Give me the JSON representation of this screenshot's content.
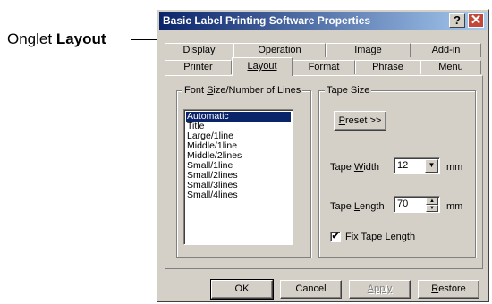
{
  "callout": {
    "prefix": "Onglet",
    "bold": "Layout"
  },
  "window": {
    "title": "Basic Label Printing Software Properties",
    "help_icon": "?",
    "close_icon": "✕"
  },
  "tabs": {
    "row_back": [
      "Display",
      "Operation",
      "Image",
      "Add-in"
    ],
    "row_front": [
      "Printer",
      "Layout",
      "Format",
      "Phrase",
      "Menu"
    ],
    "active": "Layout"
  },
  "font_group": {
    "title_pre": "Font ",
    "title_u": "S",
    "title_post": "ize/Number of Lines",
    "items": [
      "Automatic",
      "Title",
      "Large/1line",
      "Middle/1line",
      "Middle/2lines",
      "Small/1line",
      "Small/2lines",
      "Small/3lines",
      "Small/4lines"
    ],
    "selected": "Automatic"
  },
  "tape_group": {
    "title": "Tape Size",
    "preset_u": "P",
    "preset_rest": "reset >>",
    "width_pre": "Tape ",
    "width_u": "W",
    "width_post": "idth",
    "width_value": "12",
    "width_unit": "mm",
    "length_pre": "Tape ",
    "length_u": "L",
    "length_post": "ength",
    "length_value": "70",
    "length_unit": "mm",
    "fix_u": "F",
    "fix_rest": "ix Tape Length",
    "fix_checked": true,
    "check_glyph": "✔"
  },
  "buttons": {
    "ok": "OK",
    "cancel": "Cancel",
    "apply": "Apply",
    "restore_u": "R",
    "restore_rest": "estore"
  }
}
